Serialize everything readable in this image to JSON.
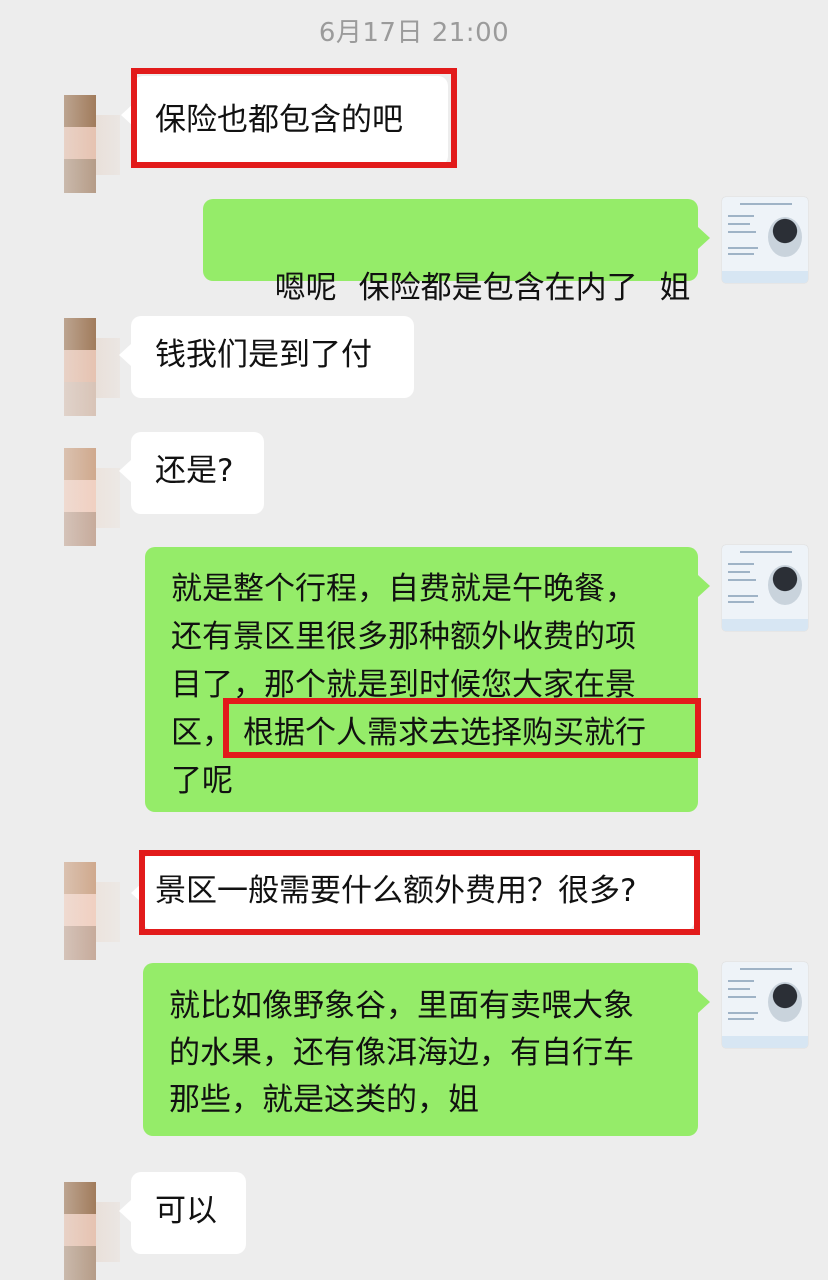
{
  "chat": {
    "timestamp": "6月17日 21:00",
    "messages": [
      {
        "side": "left",
        "text": "保险也都包含的吧",
        "highlighted": true
      },
      {
        "side": "right",
        "text": "嗯呢 保险都是包含在内了 姐"
      },
      {
        "side": "left",
        "text": "钱我们是到了付"
      },
      {
        "side": "left",
        "text": "还是?"
      },
      {
        "side": "right",
        "lines": [
          "就是整个行程，自费就是午晚餐，",
          "还有景区里很多那种额外收费的项",
          "目了，那个就是到时候您大家在景",
          "区，",
          "根据个人需求去选择购买就行",
          "了呢"
        ],
        "highlight_fragment": "根据个人需求去选择购买就行"
      },
      {
        "side": "left",
        "text": "景区一般需要什么额外费用？很多?",
        "highlighted": true
      },
      {
        "side": "right",
        "lines": [
          "就比如像野象谷，里面有卖喂大象",
          "的水果，还有像洱海边，有自行车",
          "那些，就是这类的，姐"
        ]
      },
      {
        "side": "left",
        "text": "可以"
      }
    ]
  },
  "colors": {
    "background": "#ededed",
    "sent_bubble": "#95ec69",
    "received_bubble": "#ffffff",
    "highlight_box": "#e21b1b"
  },
  "icons": {
    "left_avatar": "blurred-user-avatar",
    "right_avatar": "business-card-avatar"
  }
}
